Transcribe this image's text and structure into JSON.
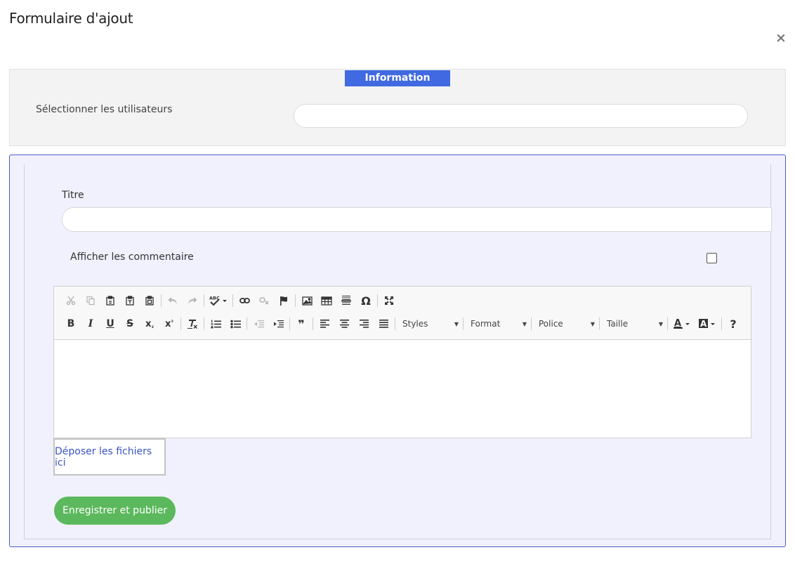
{
  "modal": {
    "title": "Formulaire d'ajout",
    "close_symbol": "×"
  },
  "information": {
    "tab_label": "Information",
    "select_users_label": "Sélectionner les utilisateurs",
    "select_users_value": ""
  },
  "form": {
    "title_label": "Titre",
    "title_value": "",
    "show_comments_label": "Afficher les commentaire",
    "show_comments_checked": false
  },
  "editor": {
    "toolbar_row1": [
      "cut-icon",
      "copy-icon",
      "paste-icon",
      "paste-text-icon",
      "paste-word-icon",
      "undo-icon",
      "redo-icon",
      "spellcheck-icon",
      "link-icon",
      "unlink-icon",
      "anchor-icon",
      "image-icon",
      "table-icon",
      "horizontal-line-icon",
      "special-char-icon",
      "maximize-icon"
    ],
    "toolbar_row2": [
      "bold-icon",
      "italic-icon",
      "underline-icon",
      "strikethrough-icon",
      "subscript-icon",
      "superscript-icon",
      "remove-format-icon",
      "numbered-list-icon",
      "bulleted-list-icon",
      "outdent-icon",
      "indent-icon",
      "blockquote-icon",
      "align-left-icon",
      "align-center-icon",
      "align-right-icon",
      "justify-icon",
      "text-color-icon",
      "background-color-icon",
      "help-icon"
    ],
    "combos": {
      "styles": "Styles",
      "format": "Format",
      "font": "Police",
      "size": "Taille"
    },
    "glyphs": {
      "bold": "B",
      "italic": "I",
      "underline": "U",
      "strike": "S",
      "sub": "x",
      "sub_mark": "₂",
      "sup": "x",
      "sup_mark": "²",
      "omega": "Ω",
      "quote": "❞",
      "help": "?",
      "spell": "ABC",
      "text_color": "A",
      "bg_color": "A"
    },
    "content": ""
  },
  "dropzone": {
    "label": "Déposer les fichiers ici"
  },
  "actions": {
    "publish_label": "Enregistrer et publier"
  },
  "colors": {
    "accent": "#4169e1",
    "panel_border": "#4a5bc8",
    "success": "#5cb85c",
    "link": "#3a54c4"
  }
}
